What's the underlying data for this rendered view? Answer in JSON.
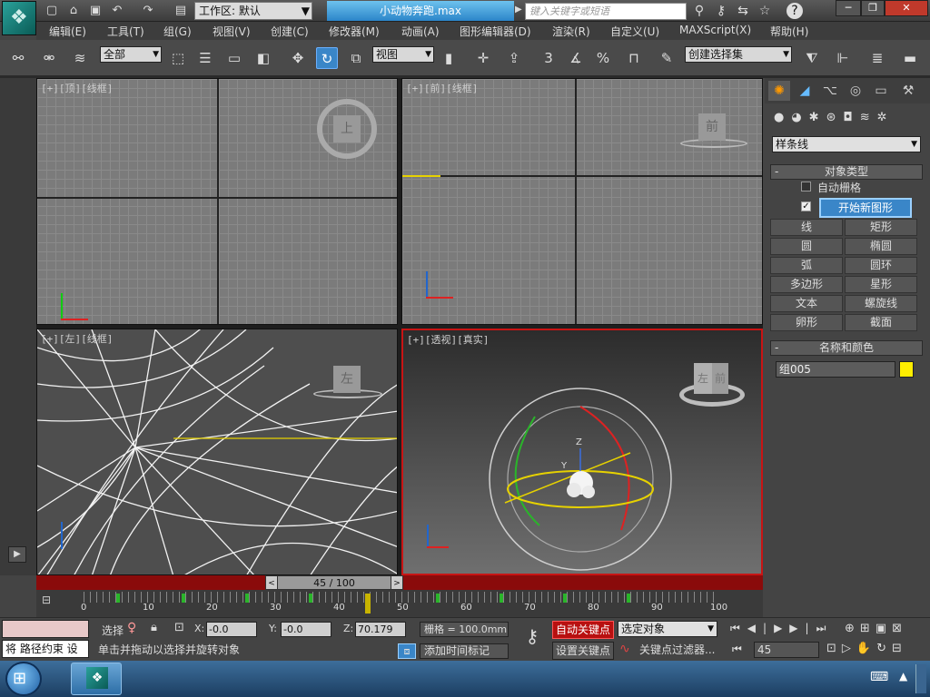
{
  "title_bar": {
    "workspace_label": "工作区: 默认",
    "document_title": "小动物奔跑.max",
    "search_placeholder": "键入关键字或短语"
  },
  "menu": [
    "编辑(E)",
    "工具(T)",
    "组(G)",
    "视图(V)",
    "创建(C)",
    "修改器(M)",
    "动画(A)",
    "图形编辑器(D)",
    "渲染(R)",
    "自定义(U)",
    "MAXScript(X)",
    "帮助(H)"
  ],
  "toolbar": {
    "selection_filter": "全部",
    "reference_coord": "视图",
    "named_selection_set": "创建选择集",
    "spinner_snap_label": "3",
    "angle_snap_label": "%"
  },
  "viewports": {
    "top": {
      "label": "[+][顶][线框]",
      "cube_face": "上"
    },
    "front": {
      "label": "[+][前][线框]",
      "cube_face": "前"
    },
    "left": {
      "label": "[+][左][线框]",
      "cube_face": "左"
    },
    "perspective": {
      "label": "[+][透视][真实]",
      "cube_face_left": "左",
      "cube_face_right": "前",
      "gizmo_axis_z": "Z",
      "gizmo_axis_y": "Y"
    }
  },
  "command_panel": {
    "category_dropdown": "样条线",
    "object_type_title": "对象类型",
    "auto_grid_label": "自动栅格",
    "start_new_shape_label": "开始新图形",
    "shape_buttons": [
      "线",
      "矩形",
      "圆",
      "椭圆",
      "弧",
      "圆环",
      "多边形",
      "星形",
      "文本",
      "螺旋线",
      "卵形",
      "截面"
    ],
    "name_color_title": "名称和颜色",
    "object_name": "组005",
    "object_color": "#ffee00"
  },
  "timeline": {
    "slider_label": "45 / 100",
    "current_frame": 45,
    "total_frames": 100,
    "ticks": [
      "0",
      "10",
      "20",
      "30",
      "40",
      "50",
      "60",
      "70",
      "80",
      "90",
      "100"
    ]
  },
  "status": {
    "maxscript_line1": "",
    "maxscript_line2": "将 路径约束 设",
    "selection_label": "选择",
    "x_label": "X:",
    "x_value": "-0.0",
    "y_label": "Y:",
    "y_value": "-0.0",
    "z_label": "Z:",
    "z_value": "70.179",
    "grid_label": "栅格 = 100.0mm",
    "prompt": "单击并拖动以选择并旋转对象",
    "add_time_tag": "添加时间标记",
    "auto_key": "自动关键点",
    "set_key": "设置关键点",
    "key_mode": "选定对象",
    "key_filters": "关键点过滤器...",
    "frame_field": "45"
  },
  "colors": {
    "active_viewport_border": "#c81414",
    "timebar_red": "#8a0b0b",
    "accent_blue": "#3a86c8"
  }
}
